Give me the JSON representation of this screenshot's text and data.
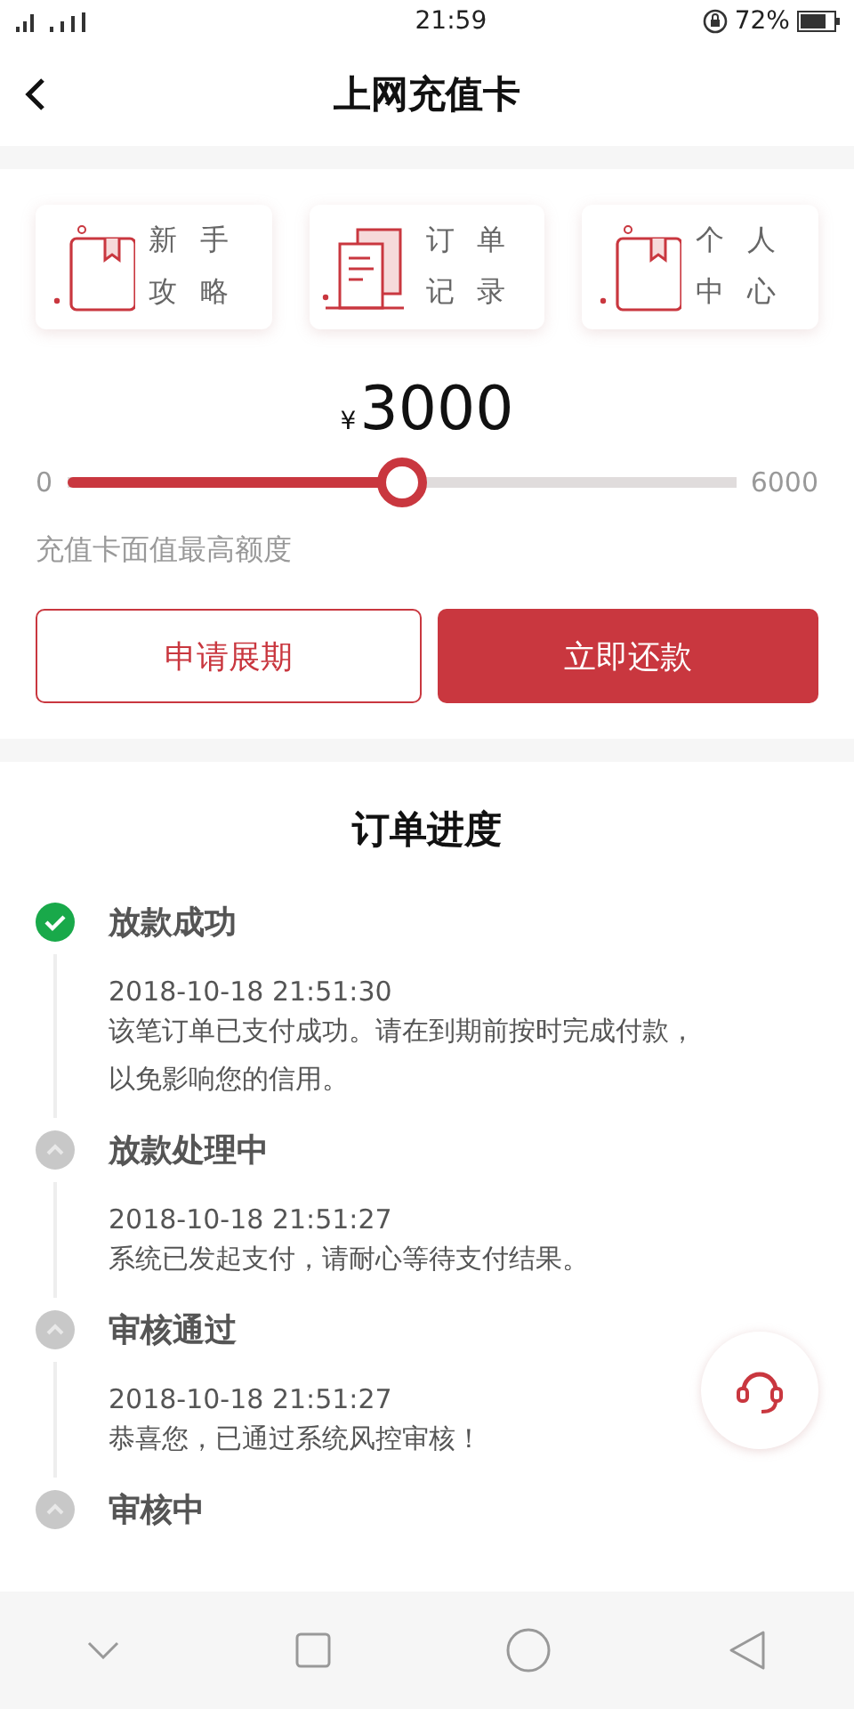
{
  "status_bar": {
    "time": "21:59",
    "battery": "72%"
  },
  "header": {
    "title": "上网充值卡"
  },
  "shortcuts": [
    {
      "label": "新手攻略",
      "kind": "book"
    },
    {
      "label": "订单记录",
      "kind": "docs"
    },
    {
      "label": "个人中心",
      "kind": "book"
    }
  ],
  "amount": {
    "currency": "¥",
    "value": "3000"
  },
  "slider": {
    "min": "0",
    "max": "6000",
    "level": 0.5
  },
  "hint": "充值卡面值最高额度",
  "buttons": [
    {
      "label": "申请展期",
      "kind": "outline"
    },
    {
      "label": "立即还款",
      "kind": "filled"
    }
  ],
  "progress": {
    "title": "订单进度",
    "steps": [
      {
        "title": "放款成功",
        "done": true,
        "time": "2018-10-18 21:51:30",
        "text": "该笔订单已支付成功。请在到期前按时完成付款，以免影响您的信用。"
      },
      {
        "title": "放款处理中",
        "done": false,
        "time": "2018-10-18 21:51:27",
        "text": "系统已发起支付，请耐心等待支付结果。"
      },
      {
        "title": "审核通过",
        "done": false,
        "time": "2018-10-18 21:51:27",
        "text": "恭喜您，已通过系统风控审核！"
      },
      {
        "title": "审核中",
        "done": false
      }
    ]
  }
}
